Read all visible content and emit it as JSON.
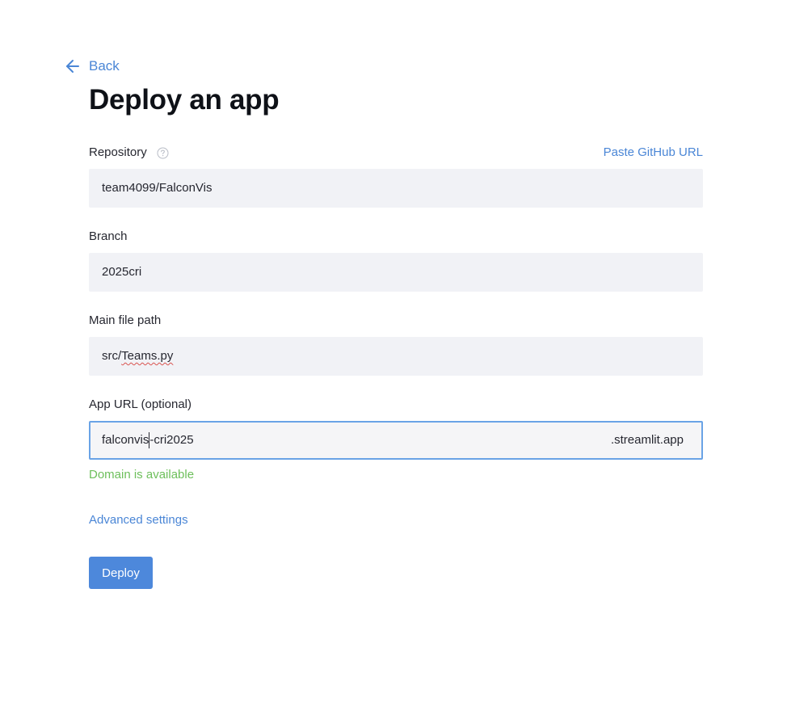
{
  "header": {
    "back_label": "Back",
    "title": "Deploy an app"
  },
  "form": {
    "repository": {
      "label": "Repository",
      "value": "team4099/FalconVis",
      "paste_link": "Paste GitHub URL"
    },
    "branch": {
      "label": "Branch",
      "value": "2025cri"
    },
    "main_file": {
      "label": "Main file path",
      "value_prefix": "src/",
      "value_flagged": "Teams.py"
    },
    "app_url": {
      "label": "App URL (optional)",
      "value_before_caret": "falconvis",
      "value_after_caret": "-cri2025",
      "suffix": ".streamlit.app",
      "status": "Domain is available"
    },
    "advanced_label": "Advanced settings",
    "deploy_label": "Deploy"
  },
  "colors": {
    "link": "#4a86d6",
    "button": "#4d88db",
    "success": "#6dbf5b",
    "input_bg": "#f1f2f6",
    "focus_border": "#6aa3e6"
  },
  "icons": {
    "back": "arrow-left-icon",
    "help": "question-circle-icon"
  }
}
